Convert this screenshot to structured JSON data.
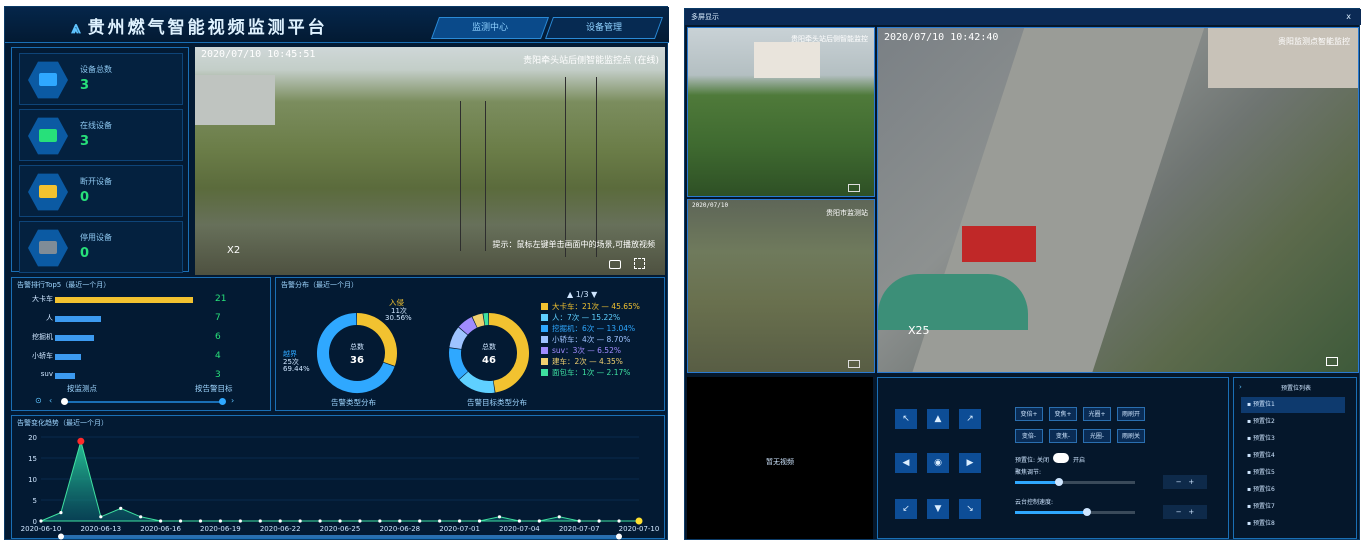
{
  "dashboard": {
    "title": "贵州燃气智能视频监测平台",
    "nav": [
      "监测中心",
      "设备管理"
    ],
    "stats": [
      {
        "label": "设备总数",
        "value": "3",
        "color": "#2fa8ff"
      },
      {
        "label": "在线设备",
        "value": "3",
        "color": "#27e07a"
      },
      {
        "label": "断开设备",
        "value": "0",
        "color": "#f2c230"
      },
      {
        "label": "停用设备",
        "value": "0",
        "color": "#7f8c97"
      }
    ],
    "video": {
      "timestamp": "2020/07/10 10:45:51",
      "name": "贵阳牵头站后侧智能监控点 (在线)",
      "zoom": "X2",
      "hint": "提示：鼠标左键单击画面中的场景,可播放视频"
    },
    "ranking": {
      "title": "告警排行Top5（最近一个月）",
      "items": [
        {
          "label": "大卡车",
          "value": 21
        },
        {
          "label": "人",
          "value": 7
        },
        {
          "label": "挖掘机",
          "value": 6
        },
        {
          "label": "小轿车",
          "value": 4
        },
        {
          "label": "suv",
          "value": 3
        }
      ],
      "footer_left": "按监测点",
      "footer_right": "按告警目标"
    },
    "distribution": {
      "title": "告警分布（最近一个月）",
      "pager": "1/3",
      "donut1": {
        "center_label": "总数",
        "total": "36",
        "caption": "告警类型分布",
        "in_label": "入侵",
        "in_count": "11次",
        "in_pct": "30.56%",
        "out_label": "越界",
        "out_count": "25次",
        "out_pct": "69.44%"
      },
      "donut2": {
        "center_label": "总数",
        "total": "46",
        "caption": "告警目标类型分布"
      },
      "legend": [
        {
          "text": "大卡车：21次 — 45.65%",
          "color": "#f2c230",
          "value": 21
        },
        {
          "text": "人：7次 — 15.22%",
          "color": "#5fd0ff",
          "value": 7
        },
        {
          "text": "挖掘机：6次 — 13.04%",
          "color": "#2fa8ff",
          "value": 6
        },
        {
          "text": "小轿车：4次 — 8.70%",
          "color": "#9ec3ff",
          "value": 4
        },
        {
          "text": "suv：3次 — 6.52%",
          "color": "#a08cff",
          "value": 3
        },
        {
          "text": "建车：2次 — 4.35%",
          "color": "#f0d070",
          "value": 2
        },
        {
          "text": "面包车：1次 — 2.17%",
          "color": "#3ee0a0",
          "value": 1
        }
      ]
    },
    "trend": {
      "title": "告警变化趋势（最近一个月）"
    }
  },
  "chart_data": {
    "type": "area",
    "title": "告警变化趋势（最近一个月）",
    "x": [
      "2020-06-10",
      "2020-06-11",
      "2020-06-12",
      "2020-06-13",
      "2020-06-14",
      "2020-06-15",
      "2020-06-16",
      "2020-06-17",
      "2020-06-18",
      "2020-06-19",
      "2020-06-20",
      "2020-06-21",
      "2020-06-22",
      "2020-06-23",
      "2020-06-24",
      "2020-06-25",
      "2020-06-26",
      "2020-06-27",
      "2020-06-28",
      "2020-06-29",
      "2020-06-30",
      "2020-07-01",
      "2020-07-02",
      "2020-07-03",
      "2020-07-04",
      "2020-07-05",
      "2020-07-06",
      "2020-07-07",
      "2020-07-08",
      "2020-07-09",
      "2020-07-10"
    ],
    "values": [
      0,
      2,
      19,
      1,
      3,
      1,
      0,
      0,
      0,
      0,
      0,
      0,
      0,
      0,
      0,
      0,
      0,
      0,
      0,
      0,
      0,
      0,
      0,
      1,
      0,
      0,
      1,
      0,
      0,
      0,
      0
    ],
    "xticks": [
      "2020-06-10",
      "2020-06-13",
      "2020-06-16",
      "2020-06-19",
      "2020-06-22",
      "2020-06-25",
      "2020-06-28",
      "2020-07-01",
      "2020-07-04",
      "2020-07-07",
      "2020-07-10"
    ],
    "yticks": [
      "0",
      "5",
      "10",
      "15",
      "20"
    ],
    "ylim": [
      0,
      20
    ]
  },
  "monitor": {
    "title": "多屏显示",
    "close": "x",
    "cams": [
      {
        "name": "贵阳牵头站后侧智能监控",
        "time": ""
      },
      {
        "name": "贵阳市监测站",
        "time": "2020/07/10"
      },
      {
        "name": "贵阳监测点智能监控",
        "time": "2020/07/10 10:42:40",
        "zoom": "X25"
      }
    ],
    "no_video": "暂无视频",
    "ptz": [
      "变倍+",
      "变焦+",
      "光圈+",
      "雨刷开",
      "变倍-",
      "变焦-",
      "光圈-",
      "雨刷关"
    ],
    "preset": "预置位",
    "speed_label": "云台控制速度:",
    "focus_label": "聚焦调节:",
    "toggle_label": "关闭",
    "toggle_on": "开启",
    "list_title": "预置位列表",
    "list": [
      "预置位1",
      "预置位2",
      "预置位3",
      "预置位4",
      "预置位5",
      "预置位6",
      "预置位7",
      "预置位8"
    ]
  }
}
